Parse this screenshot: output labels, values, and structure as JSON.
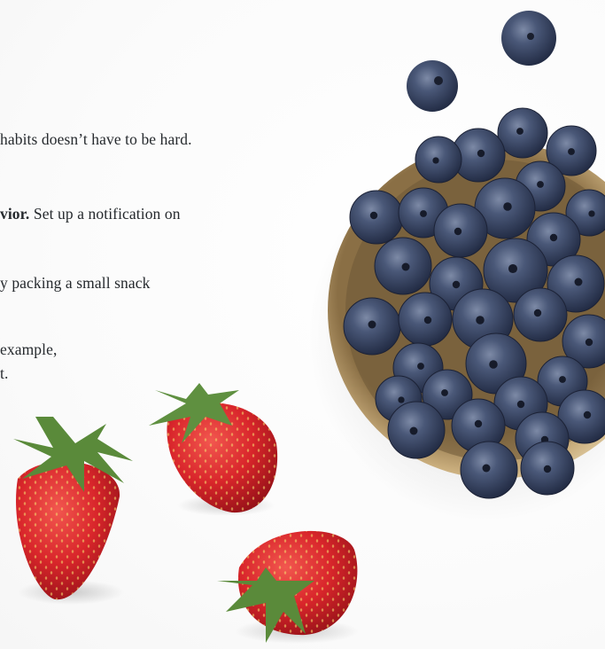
{
  "text": {
    "line1": "habits doesn’t have to be hard.",
    "line2_bold": "vior.",
    "line2_rest": " Set up a notification on",
    "line3": "y packing a small snack",
    "line4": "example,",
    "line5": "t."
  },
  "photo": {
    "subject": "blueberries in a gold bowl with fresh strawberries",
    "colors": {
      "background": "#ffffff",
      "bowl_gold": "#b89a6a",
      "blueberry": "#3d4a66",
      "strawberry": "#d9262b",
      "leaf": "#5a8a3a"
    }
  }
}
